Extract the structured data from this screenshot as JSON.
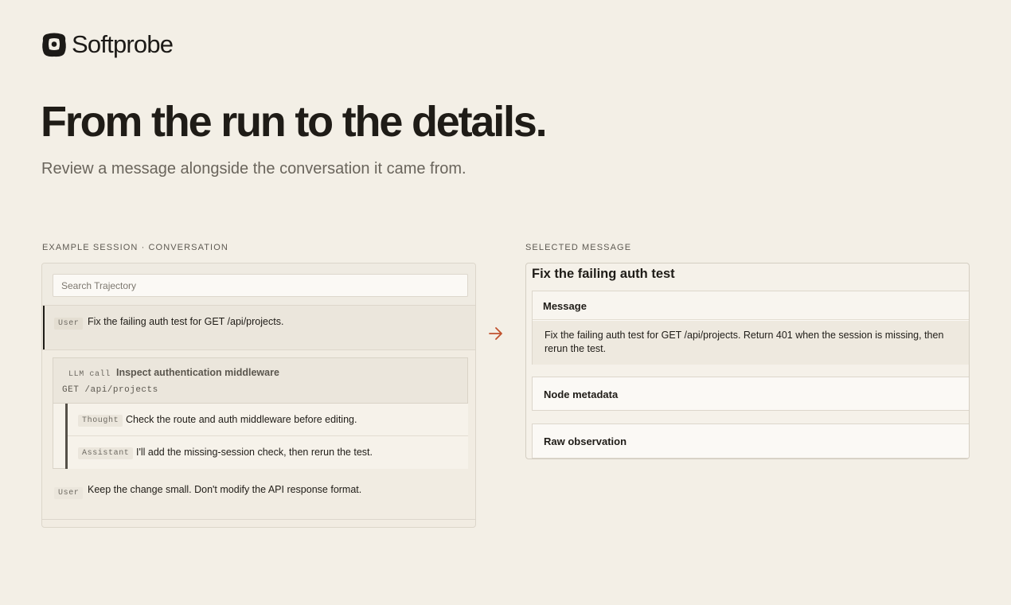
{
  "brand": {
    "name": "Softprobe"
  },
  "hero": {
    "title": "From the run to the details.",
    "subtitle": "Review a message alongside the conversation it came from."
  },
  "conversation": {
    "section_label": "EXAMPLE SESSION · CONVERSATION",
    "search_placeholder": "Search Trajectory",
    "messages": [
      {
        "role": "User",
        "text": "Fix the failing auth test for GET /api/projects."
      },
      {
        "role": "LLM call",
        "title": "Inspect authentication middleware",
        "detail": "GET /api/projects",
        "children": [
          {
            "role": "Thought",
            "text": "Check the route and auth middleware before editing."
          },
          {
            "role": "Assistant",
            "text": "I'll add the missing-session check, then rerun the test."
          }
        ]
      },
      {
        "role": "User",
        "text": "Keep the change small. Don't modify the API response format."
      }
    ]
  },
  "selected": {
    "section_label": "SELECTED MESSAGE",
    "title": "Fix the failing auth test",
    "cards": {
      "message_label": "Message",
      "message_body": "Fix the failing auth test for GET /api/projects. Return 401 when the session is missing, then rerun the test.",
      "metadata_label": "Node metadata",
      "raw_label": "Raw observation"
    }
  },
  "colors": {
    "background": "#f3efe6",
    "accent_arrow": "#c0522f",
    "text": "#1f1c17",
    "muted": "#6a655c"
  },
  "icons": {
    "logo": "softprobe-logo-icon",
    "arrow": "arrow-right-icon"
  }
}
